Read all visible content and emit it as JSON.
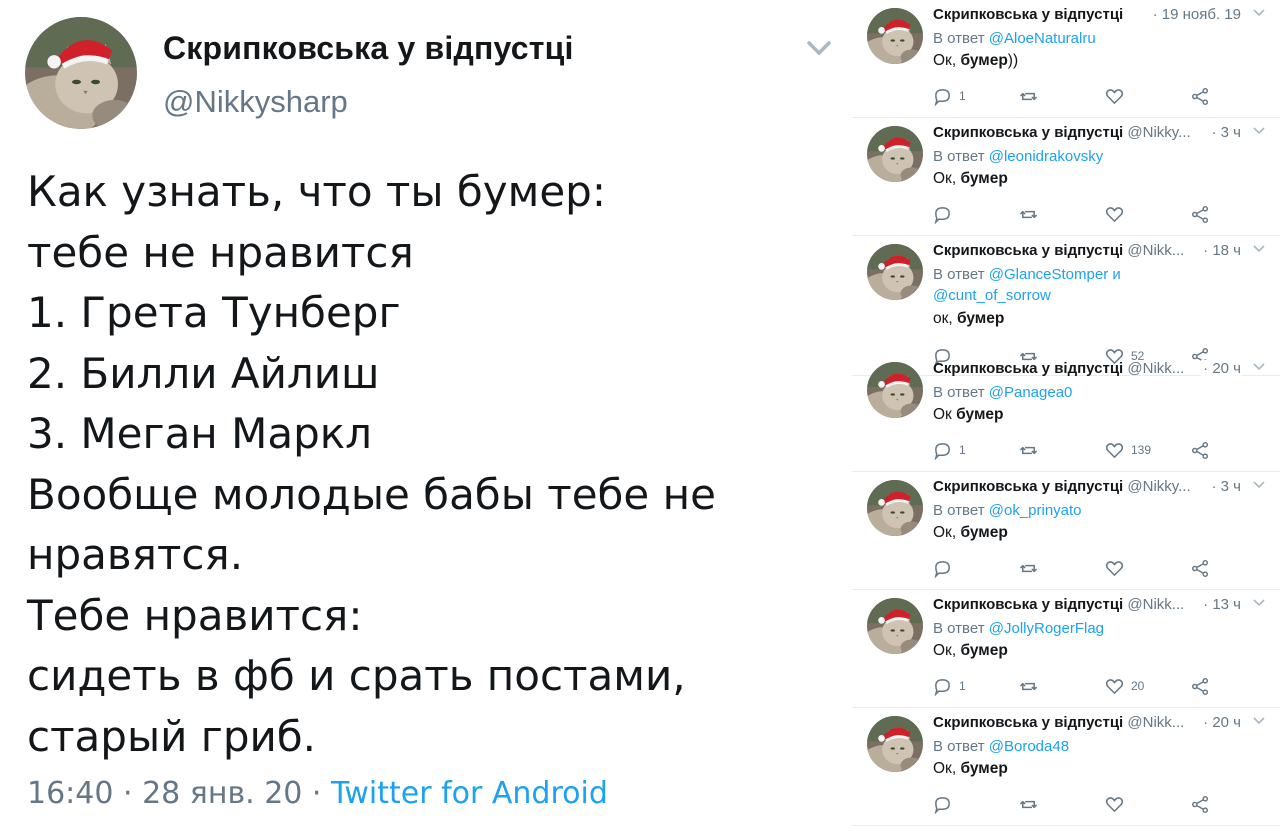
{
  "main_tweet": {
    "display_name": "Скрипковська у відпустці",
    "handle": "@Nikkysharp",
    "lines": [
      "Как узнать, что ты бумер:",
      "тебе не нравится",
      "1. Грета Тунберг",
      "2. Билли Айлиш",
      "3. Меган Маркл",
      "Вообще молодые бабы тебе не",
      "нравятся.",
      "Тебе нравится:",
      "сидеть в фб и срать постами,",
      "старый гриб."
    ],
    "time": "16:40",
    "separator": " · ",
    "date": "28 янв. 20",
    "source": "Twitter for Android"
  },
  "colors": {
    "accent": "#1da1f2",
    "muted": "#657786",
    "text": "#14171a",
    "divider": "#e6ecf0"
  },
  "icons": [
    "reply-icon",
    "retweet-icon",
    "like-icon",
    "share-icon",
    "chevron-down-icon"
  ],
  "replies": [
    {
      "name": "Скрипковська у відпустці",
      "handle": "",
      "time": "19 нояб. 19",
      "in_reply_label": "В ответ",
      "mentions": "@AloeNaturalru",
      "mentions2": "",
      "text_pre": "Ок, ",
      "text_bold": "бумер",
      "text_post": "))",
      "reply_count": "1",
      "like_count": ""
    },
    {
      "name": "Скрипковська у відпустці",
      "handle": "@Nikky...",
      "time": "3 ч",
      "in_reply_label": "В ответ",
      "mentions": "@leonidrakovsky",
      "mentions2": "",
      "text_pre": "Ок, ",
      "text_bold": "бумер",
      "text_post": "",
      "reply_count": "",
      "like_count": ""
    },
    {
      "name": "Скрипковська у відпустці",
      "handle": "@Nikk...",
      "time": "18 ч",
      "in_reply_label": "В ответ",
      "mentions": "@GlanceStomper и",
      "mentions2": "@cunt_of_sorrow",
      "text_pre": "ок, ",
      "text_bold": "бумер",
      "text_post": "",
      "reply_count": "",
      "like_count": "52"
    },
    {
      "name": "Скрипковська у відпустці",
      "handle": "@Nikk...",
      "time": "20 ч",
      "in_reply_label": "В ответ",
      "mentions": "@Panagea0",
      "mentions2": "",
      "text_pre": "Ок ",
      "text_bold": "бумер",
      "text_post": "",
      "reply_count": "1",
      "like_count": "139"
    },
    {
      "name": "Скрипковська у відпустці",
      "handle": "@Nikky...",
      "time": "3 ч",
      "in_reply_label": "В ответ",
      "mentions": "@ok_prinyato",
      "mentions2": "",
      "text_pre": "Ок, ",
      "text_bold": "бумер",
      "text_post": "",
      "reply_count": "",
      "like_count": ""
    },
    {
      "name": "Скрипковська у відпустці",
      "handle": "@Nikk...",
      "time": "13 ч",
      "in_reply_label": "В ответ",
      "mentions": "@JollyRogerFlag",
      "mentions2": "",
      "text_pre": "Ок, ",
      "text_bold": "бумер",
      "text_post": "",
      "reply_count": "1",
      "like_count": "20"
    },
    {
      "name": "Скрипковська у відпустці",
      "handle": "@Nikk...",
      "time": "20 ч",
      "in_reply_label": "В ответ",
      "mentions": "@Boroda48",
      "mentions2": "",
      "text_pre": "Ок, ",
      "text_bold": "бумер",
      "text_post": "",
      "reply_count": "",
      "like_count": ""
    }
  ]
}
